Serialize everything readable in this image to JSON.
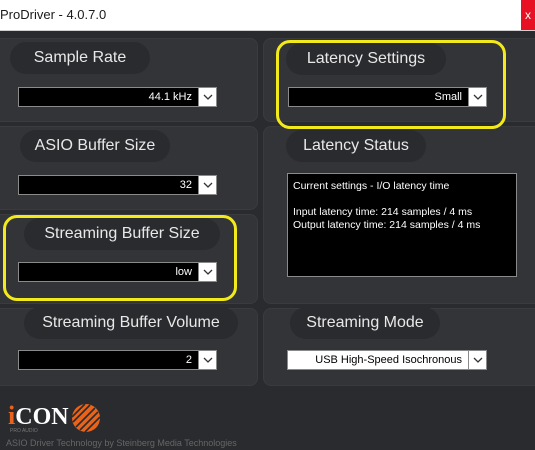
{
  "window": {
    "title": "ProDriver - 4.0.7.0",
    "close_label": "x"
  },
  "sample_rate": {
    "label": "Sample Rate",
    "value": "44.1 kHz"
  },
  "latency_settings": {
    "label": "Latency Settings",
    "value": "Small"
  },
  "asio_buffer": {
    "label": "ASIO Buffer Size",
    "value": "32"
  },
  "latency_status": {
    "label": "Latency Status",
    "line1": "Current settings - I/O latency time",
    "line2": "Input latency time: 214 samples / 4 ms",
    "line3": "Output latency time: 214 samples / 4 ms"
  },
  "streaming_buffer_size": {
    "label": "Streaming Buffer Size",
    "value": "low"
  },
  "streaming_buffer_volume": {
    "label": "Streaming Buffer Volume",
    "value": "2"
  },
  "streaming_mode": {
    "label": "Streaming Mode",
    "value": "USB High-Speed Isochronous"
  },
  "brand": {
    "logo_text": "iCON",
    "tagline": "ASIO Driver Technology by Steinberg Media Technologies"
  },
  "colors": {
    "highlight": "#f2ea1b",
    "background": "#2a2b2e",
    "panel": "#333438"
  }
}
